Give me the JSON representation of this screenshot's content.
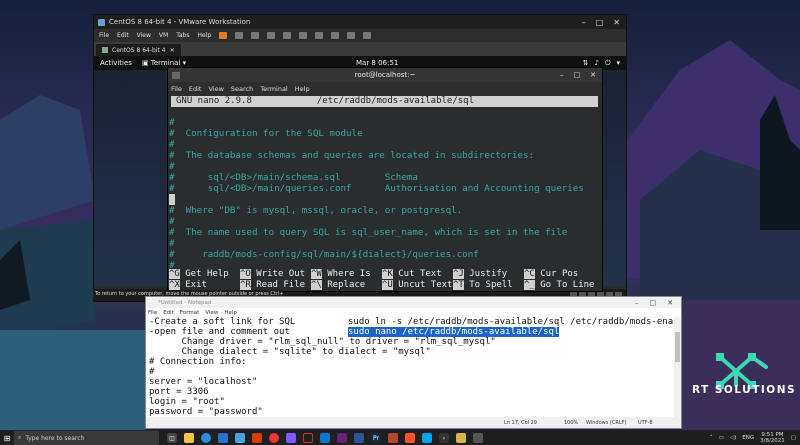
{
  "vmware": {
    "title": "CentOS 8 64-bit 4 - VMware Workstation",
    "menu": [
      "File",
      "Edit",
      "View",
      "VM",
      "Tabs",
      "Help"
    ],
    "tab": "CentOS 8 64-bit 4",
    "status_tip": "To return to your computer, move the mouse pointer outside or press Ctrl+Alt."
  },
  "gnome": {
    "activities": "Activities",
    "app": "Terminal",
    "clock": "Mar 8  06:51"
  },
  "terminal": {
    "title": "root@localhost:~",
    "menu": [
      "File",
      "Edit",
      "View",
      "Search",
      "Terminal",
      "Help"
    ],
    "nano_header": "GNU nano 2.9.8            /etc/raddb/mods-available/sql",
    "lines": [
      "#",
      "#  Configuration for the SQL module",
      "#",
      "#  The database schemas and queries are located in subdirectories:",
      "#",
      "#      sql/<DB>/main/schema.sql        Schema",
      "#      sql/<DB>/main/queries.conf      Authorisation and Accounting queries",
      "",
      "#  Where \"DB\" is mysql, mssql, oracle, or postgresql.",
      "#",
      "#  The name used to query SQL is sql_user_name, which is set in the file",
      "#",
      "#     raddb/mods-config/sql/main/${dialect}/queries.conf",
      "#"
    ],
    "keys_row1": [
      {
        "code": "^G",
        "label": "Get Help"
      },
      {
        "code": "^O",
        "label": "Write Out"
      },
      {
        "code": "^W",
        "label": "Where Is"
      },
      {
        "code": "^K",
        "label": "Cut Text"
      },
      {
        "code": "^J",
        "label": "Justify"
      },
      {
        "code": "^C",
        "label": "Cur Pos"
      }
    ],
    "keys_row2": [
      {
        "code": "^X",
        "label": "Exit"
      },
      {
        "code": "^R",
        "label": "Read File"
      },
      {
        "code": "^\\",
        "label": "Replace"
      },
      {
        "code": "^U",
        "label": "Uncut Text"
      },
      {
        "code": "^T",
        "label": "To Spell"
      },
      {
        "code": "^_",
        "label": "Go To Line"
      }
    ]
  },
  "notepad": {
    "title": "*Untitled - Notepad",
    "menu": [
      "File",
      "Edit",
      "Format",
      "View",
      "Help"
    ],
    "lines": [
      "-Create a soft link for SQL",
      "-open file and comment out",
      "      Change driver = \"rlm_sql_null\" to driver = \"rlm_sql_mysql\"",
      "      Change dialect = \"sqlite\" to dialect = \"mysql\"",
      "# Connection info:",
      "#",
      "server = \"localhost\"",
      "port = 3306",
      "login = \"root\"",
      "password = \"password\""
    ],
    "cmd1": "sudo ln -s /etc/raddb/mods-available/sql /etc/raddb/mods-enabled/",
    "cmd2_selected": "sudo nano /etc/raddb/mods-available/sql",
    "status": {
      "position": "Ln 17, Col 29",
      "zoom": "100%",
      "eol": "Windows (CRLF)",
      "encoding": "UTF-8"
    }
  },
  "taskbar": {
    "search_placeholder": "Type here to search",
    "lang": "ENG",
    "time": "9:51 PM",
    "date": "3/8/2021"
  },
  "logo": {
    "text": "RT SOLUTIONS"
  }
}
